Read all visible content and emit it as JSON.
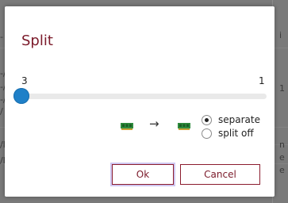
{
  "background": {
    "right_fragments": [
      "i",
      "1",
      "n",
      "e",
      "e"
    ],
    "left_fragments": [
      "-",
      "-/",
      "-/",
      "-/",
      "/",
      "/l",
      "/l"
    ]
  },
  "dialog": {
    "title": "Split",
    "slider": {
      "min_label": "3",
      "max_label": "1",
      "value": 3
    },
    "transform": {
      "from_icon": "memory-module-icon",
      "arrow": "→",
      "to_icon": "memory-module-icon"
    },
    "options": [
      {
        "label": "separate",
        "checked": true
      },
      {
        "label": "split off",
        "checked": false
      }
    ],
    "buttons": {
      "ok_label": "Ok",
      "cancel_label": "Cancel"
    }
  },
  "colors": {
    "accent": "#7b1a2a",
    "slider_thumb": "#1f80c8",
    "module_green": "#2e8b3d"
  }
}
